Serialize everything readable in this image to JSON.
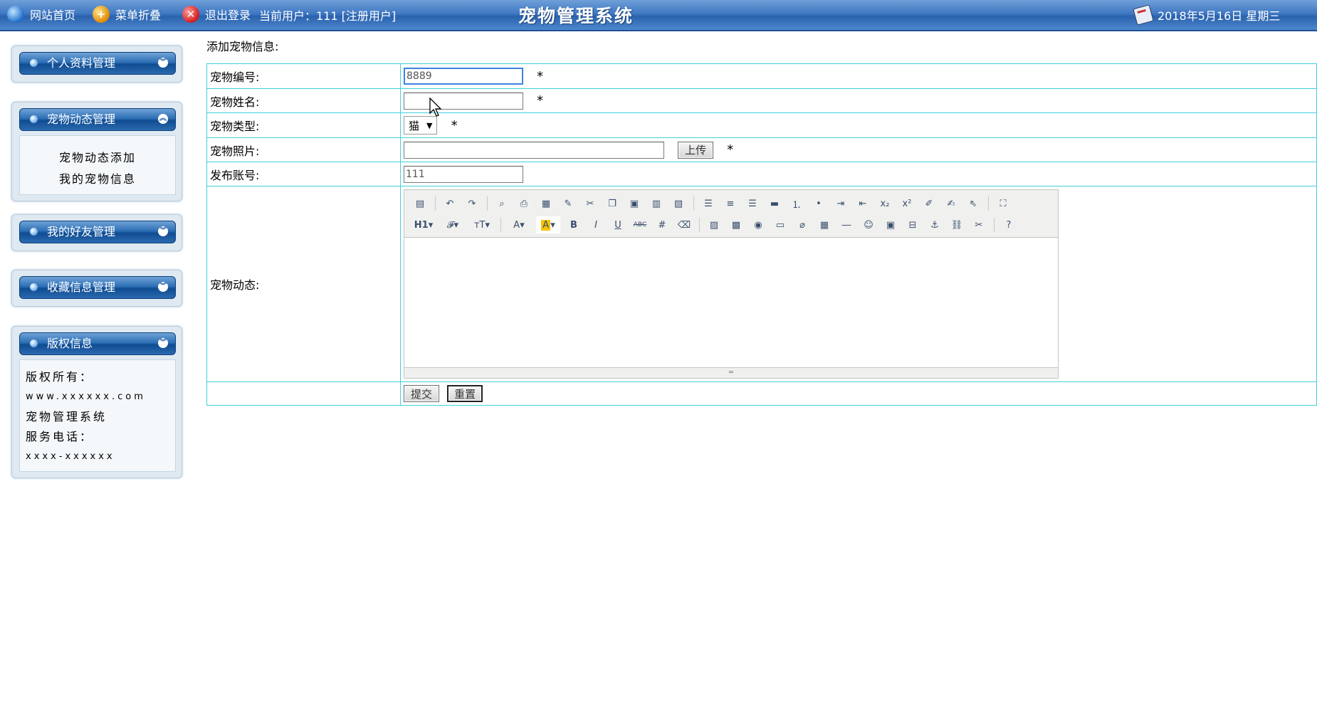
{
  "topbar": {
    "home_label": "网站首页",
    "menu_toggle_label": "菜单折叠",
    "logout_label": "退出登录",
    "current_user_text": "当前用户：111  [注册用户]",
    "system_title": "宠物管理系统",
    "date_text": "2018年5月16日 星期三"
  },
  "sidebar": {
    "panels": [
      {
        "title": "个人资料管理"
      },
      {
        "title": "宠物动态管理",
        "links": [
          "宠物动态添加",
          "我的宠物信息"
        ]
      },
      {
        "title": "我的好友管理"
      },
      {
        "title": "收藏信息管理"
      },
      {
        "title": "版权信息",
        "lines": [
          "版权所有：",
          "www.xxxxxx.com",
          "宠物管理系统",
          "服务电话：",
          "xxxx-xxxxxx"
        ]
      }
    ]
  },
  "form": {
    "title": "添加宠物信息:",
    "pet_id_label": "宠物编号:",
    "pet_id_value": "8889",
    "pet_name_label": "宠物姓名:",
    "pet_name_value": "",
    "pet_type_label": "宠物类型:",
    "pet_type_value": "猫",
    "pet_photo_label": "宠物照片:",
    "pet_photo_value": "",
    "upload_button": "上传",
    "account_label": "发布账号:",
    "account_value": "111",
    "dynamics_label": "宠物动态:",
    "required_mark": "*",
    "submit_button": "提交",
    "reset_button": "重置"
  },
  "editor_toolbar": {
    "row1": [
      "source-icon",
      "undo-icon",
      "redo-icon",
      "preview-icon",
      "print-icon",
      "templates-icon",
      "spellcheck-icon",
      "cut-icon",
      "copy-icon",
      "paste-icon",
      "paste-text-icon",
      "paste-word-icon",
      "align-left-icon",
      "align-center-icon",
      "align-right-icon",
      "justify-icon",
      "ordered-list-icon",
      "unordered-list-icon",
      "indent-icon",
      "outdent-icon",
      "subscript-icon",
      "superscript-icon",
      "clear-format-icon",
      "select-all-icon",
      "selection-icon",
      "fullscreen-icon"
    ],
    "row2_text": {
      "heading": "H1",
      "bold": "B",
      "italic": "I",
      "underline": "U",
      "strike": "ABC",
      "font_color": "A"
    }
  },
  "colors": {
    "topbar": "#2a62ad",
    "table_border": "#3fd0de",
    "panel_header": "#1a5aa3"
  }
}
